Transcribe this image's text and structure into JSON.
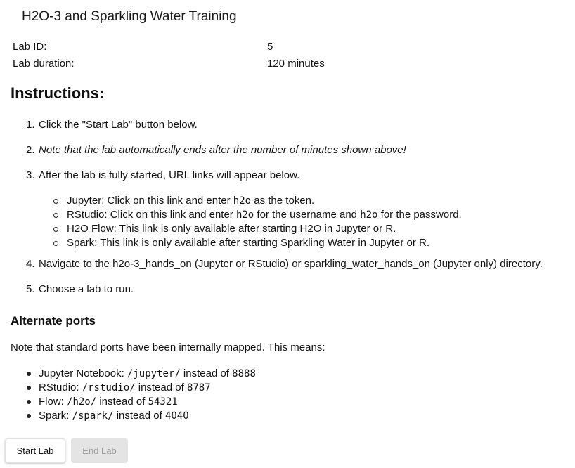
{
  "header": {
    "title": "H2O-3 and Sparkling Water Training"
  },
  "info": {
    "lab_id_label": "Lab ID:",
    "lab_id_value": "5",
    "duration_label": "Lab duration:",
    "duration_value": "120 minutes"
  },
  "instructions": {
    "heading": "Instructions:",
    "steps": [
      {
        "num": "1.",
        "text": "Click the \"Start Lab\" button below."
      },
      {
        "num": "2.",
        "text": "Note that the lab automatically ends after the number of minutes shown above!"
      },
      {
        "num": "3.",
        "text": "After the lab is fully started, URL links will appear below."
      },
      {
        "num": "4.",
        "text": "Navigate to the h2o-3_hands_on (Jupyter or RStudio) or sparkling_water_hands_on (Jupyter only) directory."
      },
      {
        "num": "5.",
        "text": "Choose a lab to run."
      }
    ],
    "links": {
      "jupyter_pre": "Jupyter: Click on this link and enter ",
      "jupyter_code": "h2o",
      "jupyter_post": " as the token.",
      "rstudio_pre": "RStudio: Click on this link and enter ",
      "rstudio_code1": "h2o",
      "rstudio_mid": " for the username and ",
      "rstudio_code2": "h2o",
      "rstudio_post": " for the password.",
      "flow_text": "H2O Flow: This link is only available after starting H2O in Jupyter or R.",
      "spark_text": "Spark: This link is only available after starting Sparkling Water in Jupyter or R."
    }
  },
  "alternate_ports": {
    "heading": "Alternate ports",
    "note": "Note that standard ports have been internally mapped. This means:",
    "items": [
      {
        "label": "Jupyter Notebook: ",
        "path": "/jupyter/",
        "mid": " instead of ",
        "port": "8888"
      },
      {
        "label": "RStudio: ",
        "path": "/rstudio/",
        "mid": " instead of ",
        "port": "8787"
      },
      {
        "label": "Flow: ",
        "path": "/h2o/",
        "mid": " instead of ",
        "port": "54321"
      },
      {
        "label": "Spark: ",
        "path": "/spark/",
        "mid": " instead of ",
        "port": "4040"
      }
    ]
  },
  "buttons": {
    "start_label": "Start Lab",
    "end_label": "End Lab"
  }
}
